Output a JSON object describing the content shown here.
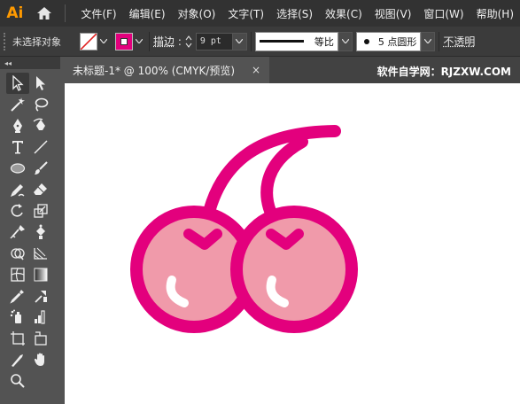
{
  "app": {
    "logo_text": "Ai"
  },
  "menu": [
    "文件(F)",
    "编辑(E)",
    "对象(O)",
    "文字(T)",
    "选择(S)",
    "效果(C)",
    "视图(V)",
    "窗口(W)",
    "帮助(H)"
  ],
  "control_bar": {
    "selection_label": "未选择对象",
    "stroke_label": "描边",
    "stroke_weight": "9 pt",
    "stroke_profile": "等比",
    "brush_label": "5 点圆形",
    "opacity_label": "不透明"
  },
  "tools_header": "◂◂",
  "document": {
    "tab_title": "未标题-1* @ 100% (CMYK/预览)",
    "close_symbol": "×",
    "watermark": "软件自学网：RJZXW.COM"
  },
  "colors": {
    "cherry_stroke": "#e3007d",
    "cherry_fill": "#f09aaa",
    "highlight": "#ffffff",
    "ui_dark": "#323232",
    "ui_panel": "#535353"
  },
  "icons": {
    "tools": [
      "selection-tool",
      "direct-selection-tool",
      "magic-wand-tool",
      "lasso-tool",
      "pen-tool",
      "curvature-tool",
      "type-tool",
      "line-tool",
      "ellipse-tool",
      "paintbrush-tool",
      "shaper-tool",
      "eraser-tool",
      "rotate-tool",
      "scale-tool",
      "warp-tool",
      "free-transform-tool",
      "shape-builder-tool",
      "perspective-grid-tool",
      "mesh-tool",
      "gradient-tool",
      "eyedropper-tool",
      "blend-tool",
      "symbol-sprayer-tool",
      "column-graph-tool",
      "artboard-tool",
      "slice-tool",
      "hand-tool",
      "zoom-tool"
    ]
  }
}
